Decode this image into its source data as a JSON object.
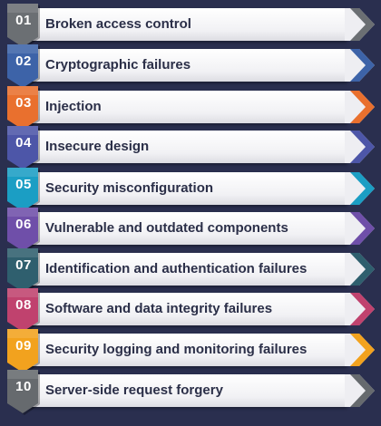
{
  "items": [
    {
      "number": "01",
      "label": "Broken access control",
      "color": "#6b6f73"
    },
    {
      "number": "02",
      "label": "Cryptographic failures",
      "color": "#3d63a8"
    },
    {
      "number": "03",
      "label": "Injection",
      "color": "#e9702e"
    },
    {
      "number": "04",
      "label": "Insecure design",
      "color": "#4d56a8"
    },
    {
      "number": "05",
      "label": "Security misconfiguration",
      "color": "#1b9ec4"
    },
    {
      "number": "06",
      "label": "Vulnerable and outdated components",
      "color": "#6f4fa9"
    },
    {
      "number": "07",
      "label": "Identification and authentication failures",
      "color": "#2f5f6e"
    },
    {
      "number": "08",
      "label": "Software and data integrity failures",
      "color": "#c0426e"
    },
    {
      "number": "09",
      "label": "Security logging and monitoring failures",
      "color": "#f2a21e"
    },
    {
      "number": "10",
      "label": "Server-side request forgery",
      "color": "#666a6e"
    }
  ]
}
